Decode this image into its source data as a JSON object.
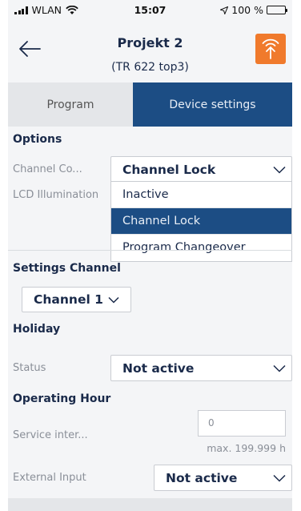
{
  "status_bar": {
    "carrier": "WLAN",
    "time": "15:07",
    "battery": "100 %"
  },
  "header": {
    "title": "Projekt 2",
    "subtitle": "(TR 622 top3)"
  },
  "tabs": [
    {
      "label": "Program",
      "active": false
    },
    {
      "label": "Device settings",
      "active": true
    }
  ],
  "options": {
    "section_title": "Options",
    "channel_control": {
      "label": "Channel Co...",
      "value": "Channel Lock"
    },
    "lcd_illumination": {
      "label": "LCD Illumination"
    },
    "dropdown_options": [
      "Inactive",
      "Channel Lock",
      "Program Changeover"
    ],
    "dropdown_selected": "Channel Lock"
  },
  "settings_channel": {
    "section_title": "Settings Channel",
    "value": "Channel 1"
  },
  "holiday": {
    "section_title": "Holiday",
    "status_label": "Status",
    "status_value": "Not active"
  },
  "operating_hour": {
    "section_title": "Operating Hour",
    "service_label": "Service inter...",
    "service_placeholder": "0",
    "service_hint": "max. 199.999 h",
    "external_input_label": "External Input",
    "external_input_value": "Not active"
  },
  "colors": {
    "accent": "#1c4d84",
    "upload": "#f07a2c",
    "battery": "#35c759"
  }
}
